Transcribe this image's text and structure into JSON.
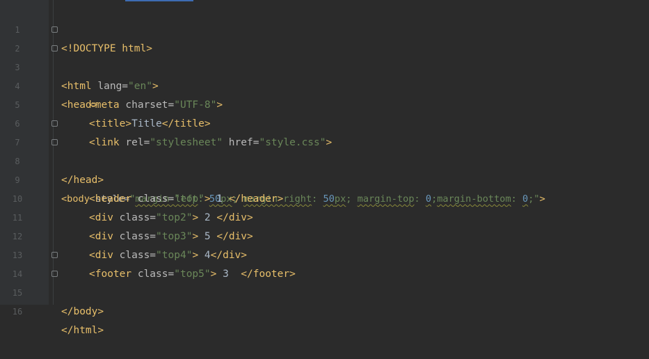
{
  "editor": {
    "line_numbers": [
      "1",
      "2",
      "3",
      "4",
      "5",
      "6",
      "7",
      "8",
      "9",
      "10",
      "11",
      "12",
      "13",
      "14",
      "15",
      "16"
    ],
    "lines": {
      "l1": {
        "a": "<!DOCTYPE html>"
      },
      "l2": {
        "a": "<html ",
        "b": "lang=",
        "c": "\"en\"",
        "d": ">"
      },
      "l3": {
        "a": "<head>"
      },
      "l4": {
        "a": "<meta ",
        "b": "charset=",
        "c": "\"UTF-8\"",
        "d": ">"
      },
      "l5": {
        "a": "<title>",
        "b": "Title",
        "c": "</title>"
      },
      "l6": {
        "a": "<link ",
        "b": "rel=",
        "c": "\"stylesheet\"",
        "d": " href=",
        "e": "\"style.css\"",
        "f": ">"
      },
      "l7": {
        "a": "</head>"
      },
      "l8": {
        "a": "<body ",
        "b": "style=",
        "c": "\"",
        "d": "margin-left",
        "e": ": ",
        "f": "50",
        "g": "px",
        "h": "; ",
        "i": "margin-right",
        "j": ": ",
        "k": "50",
        "l": "px",
        "m": "; ",
        "n": "margin-top",
        "o": ": ",
        "p": "0",
        "q": ";",
        "r": "margin-bottom",
        "s": ": ",
        "t": "0",
        "u": ";\"",
        "v": ">"
      },
      "l9": {
        "a": "<header ",
        "b": "class=",
        "c": "\"top\"",
        "d": ">",
        "e": " 1 ",
        "f": "</header>"
      },
      "l10": {
        "a": "<div ",
        "b": "class=",
        "c": "\"top2\"",
        "d": ">",
        "e": " 2 ",
        "f": "</div>"
      },
      "l11": {
        "a": "<div ",
        "b": "class=",
        "c": "\"top3\"",
        "d": ">",
        "e": " 5 ",
        "f": "</div>"
      },
      "l12": {
        "a": "<div ",
        "b": "class=",
        "c": "\"top4\"",
        "d": ">",
        "e": " 4",
        "f": "</div>"
      },
      "l13": {
        "a": "<footer ",
        "b": "class=",
        "c": "\"top5\"",
        "d": ">",
        "e": " 3  ",
        "f": "</footer>"
      },
      "l14": {
        "a": "</body>"
      },
      "l15": {
        "a": "</html>"
      }
    }
  },
  "colors": {
    "background": "#2b2b2b",
    "gutter": "#313335",
    "tag": "#e8bf6a",
    "attribute": "#bababa",
    "string": "#6a8759",
    "number": "#6897bb",
    "text": "#a9b7c6",
    "line_number": "#5a5d5f"
  }
}
